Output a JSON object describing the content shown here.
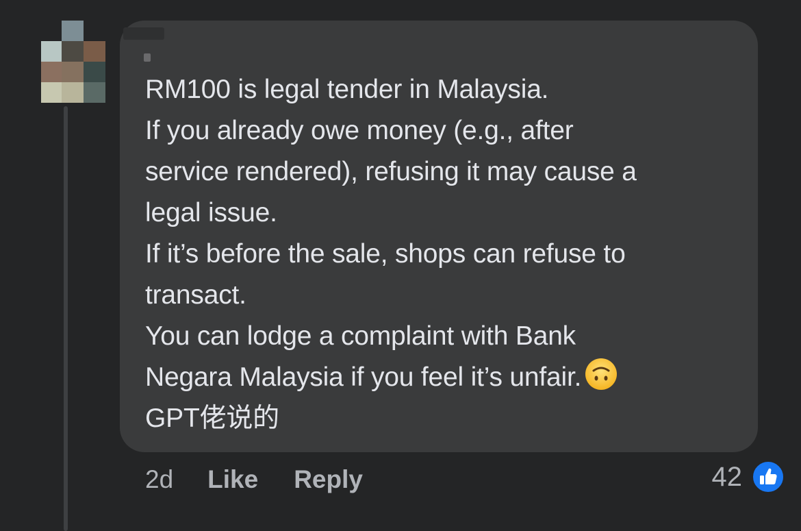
{
  "comment": {
    "lines": [
      "RM100 is legal tender in Malaysia.",
      "If you already owe money (e.g., after",
      "service rendered), refusing it may cause a",
      "legal issue.",
      "If it’s before the sale, shops can refuse to",
      "transact.",
      "You can lodge a complaint with Bank",
      "Negara Malaysia if you feel it’s unfair.",
      "GPT佬说的"
    ],
    "emoji": "upside-down-face"
  },
  "actions": {
    "time": "2d",
    "like_label": "Like",
    "reply_label": "Reply"
  },
  "reactions": {
    "count": "42",
    "type": "like-icon",
    "color": "#1877f2"
  },
  "colors": {
    "background": "#242526",
    "bubble": "#3a3b3c",
    "text": "#e4e6eb",
    "secondary": "#b0b3b8"
  }
}
